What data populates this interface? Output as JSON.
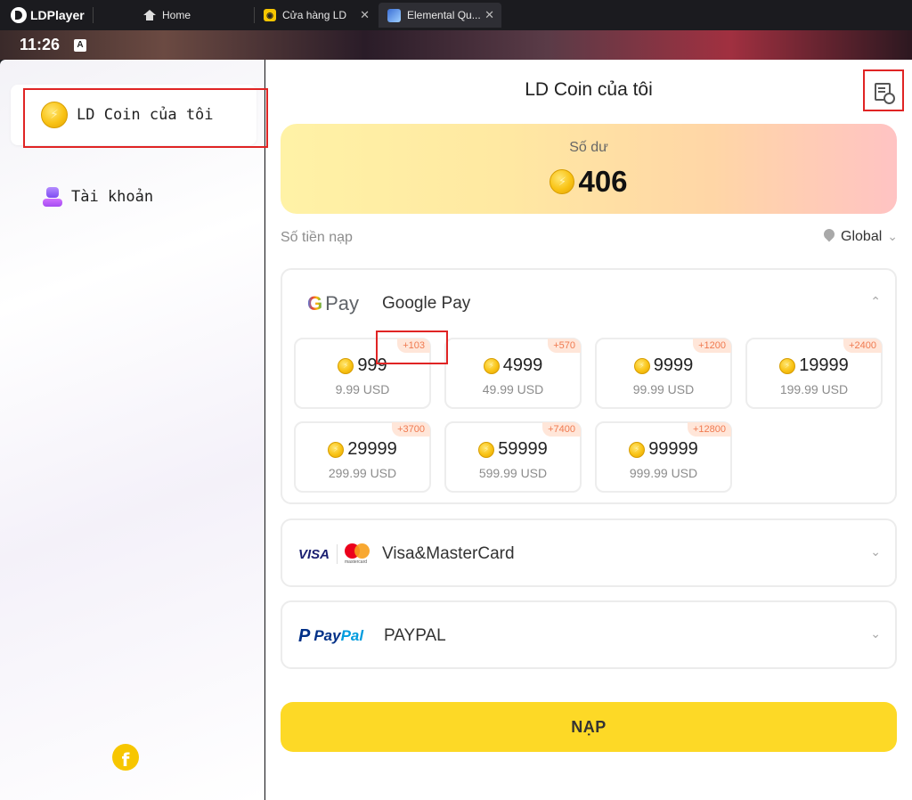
{
  "titlebar": {
    "brand": "LDPlayer",
    "tabs": [
      {
        "label": "Home",
        "closable": false
      },
      {
        "label": "Cửa hàng LD",
        "closable": true
      },
      {
        "label": "Elemental Qu...",
        "closable": true
      }
    ],
    "close_glyph": "✕"
  },
  "statusbar": {
    "time": "11:26",
    "indicator": "A"
  },
  "sidebar": {
    "items": [
      {
        "label": "LD Coin của tôi",
        "icon": "coin-icon",
        "active": true
      },
      {
        "label": "Tài khoản",
        "icon": "account-icon",
        "active": false
      }
    ],
    "footer_icon": "facebook-icon",
    "footer_glyph": "f"
  },
  "main": {
    "title": "LD Coin của tôi",
    "history_icon": "history-icon",
    "balance": {
      "label": "Số dư",
      "value": "406"
    },
    "amount_label": "Số tiền nạp",
    "region": "Global",
    "payment_methods": [
      {
        "name": "Google Pay",
        "logo": "Pay",
        "logo_g": "G",
        "expanded": true,
        "packages": [
          {
            "coins": "999",
            "bonus": "+103",
            "price": "9.99 USD"
          },
          {
            "coins": "4999",
            "bonus": "+570",
            "price": "49.99 USD"
          },
          {
            "coins": "9999",
            "bonus": "+1200",
            "price": "99.99 USD"
          },
          {
            "coins": "19999",
            "bonus": "+2400",
            "price": "199.99 USD"
          },
          {
            "coins": "29999",
            "bonus": "+3700",
            "price": "299.99 USD"
          },
          {
            "coins": "59999",
            "bonus": "+7400",
            "price": "599.99 USD"
          },
          {
            "coins": "99999",
            "bonus": "+12800",
            "price": "999.99 USD"
          }
        ]
      },
      {
        "name": "Visa&MasterCard",
        "logo": "VISA",
        "logo_sub": "mastercard",
        "expanded": false
      },
      {
        "name": "PAYPAL",
        "logo_p": "P",
        "logo_pay": "Pay",
        "logo_pal": "Pal",
        "expanded": false
      }
    ],
    "submit_label": "NẠP"
  },
  "colors": {
    "accent": "#fdd926",
    "highlight": "#e02424",
    "bonus": "#f07a50"
  }
}
